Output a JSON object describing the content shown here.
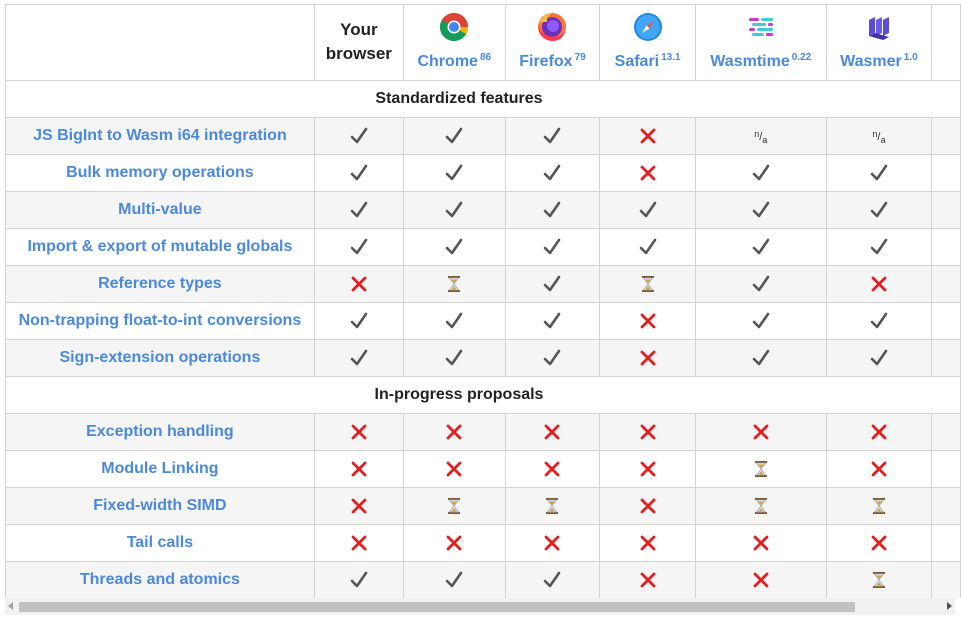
{
  "header": {
    "your_browser": "Your browser",
    "engines": [
      {
        "name": "Chrome",
        "version": "86",
        "icon": "chrome-logo-icon"
      },
      {
        "name": "Firefox",
        "version": "79",
        "icon": "firefox-logo-icon"
      },
      {
        "name": "Safari",
        "version": "13.1",
        "icon": "safari-logo-icon"
      },
      {
        "name": "Wasmtime",
        "version": "0.22",
        "icon": "wasmtime-logo-icon"
      },
      {
        "name": "Wasmer",
        "version": "1.0",
        "icon": "wasmer-logo-icon"
      }
    ]
  },
  "status_legend": {
    "yes": "check-icon",
    "no": "cross-icon",
    "flag": "hourglass-icon",
    "na": "n/a"
  },
  "sections": [
    {
      "title": "Standardized features",
      "rows": [
        {
          "feature": "JS BigInt to Wasm i64 integration",
          "status": [
            "yes",
            "yes",
            "yes",
            "no",
            "na",
            "na"
          ]
        },
        {
          "feature": "Bulk memory operations",
          "status": [
            "yes",
            "yes",
            "yes",
            "no",
            "yes",
            "yes"
          ]
        },
        {
          "feature": "Multi-value",
          "status": [
            "yes",
            "yes",
            "yes",
            "yes",
            "yes",
            "yes"
          ]
        },
        {
          "feature": "Import & export of mutable globals",
          "status": [
            "yes",
            "yes",
            "yes",
            "yes",
            "yes",
            "yes"
          ]
        },
        {
          "feature": "Reference types",
          "status": [
            "no",
            "flag",
            "yes",
            "flag",
            "yes",
            "no"
          ]
        },
        {
          "feature": "Non-trapping float-to-int conversions",
          "status": [
            "yes",
            "yes",
            "yes",
            "no",
            "yes",
            "yes"
          ]
        },
        {
          "feature": "Sign-extension operations",
          "status": [
            "yes",
            "yes",
            "yes",
            "no",
            "yes",
            "yes"
          ]
        }
      ]
    },
    {
      "title": "In-progress proposals",
      "rows": [
        {
          "feature": "Exception handling",
          "status": [
            "no",
            "no",
            "no",
            "no",
            "no",
            "no"
          ]
        },
        {
          "feature": "Module Linking",
          "status": [
            "no",
            "no",
            "no",
            "no",
            "flag",
            "no"
          ]
        },
        {
          "feature": "Fixed-width SIMD",
          "status": [
            "no",
            "flag",
            "flag",
            "no",
            "flag",
            "flag"
          ]
        },
        {
          "feature": "Tail calls",
          "status": [
            "no",
            "no",
            "no",
            "no",
            "no",
            "no"
          ]
        },
        {
          "feature": "Threads and atomics",
          "status": [
            "yes",
            "yes",
            "yes",
            "no",
            "no",
            "flag"
          ]
        }
      ]
    }
  ],
  "colors": {
    "link": "#4a89dc",
    "check": "#555555",
    "cross": "#e02020",
    "border": "#d3d3d3",
    "stripe": "#f5f5f5"
  }
}
